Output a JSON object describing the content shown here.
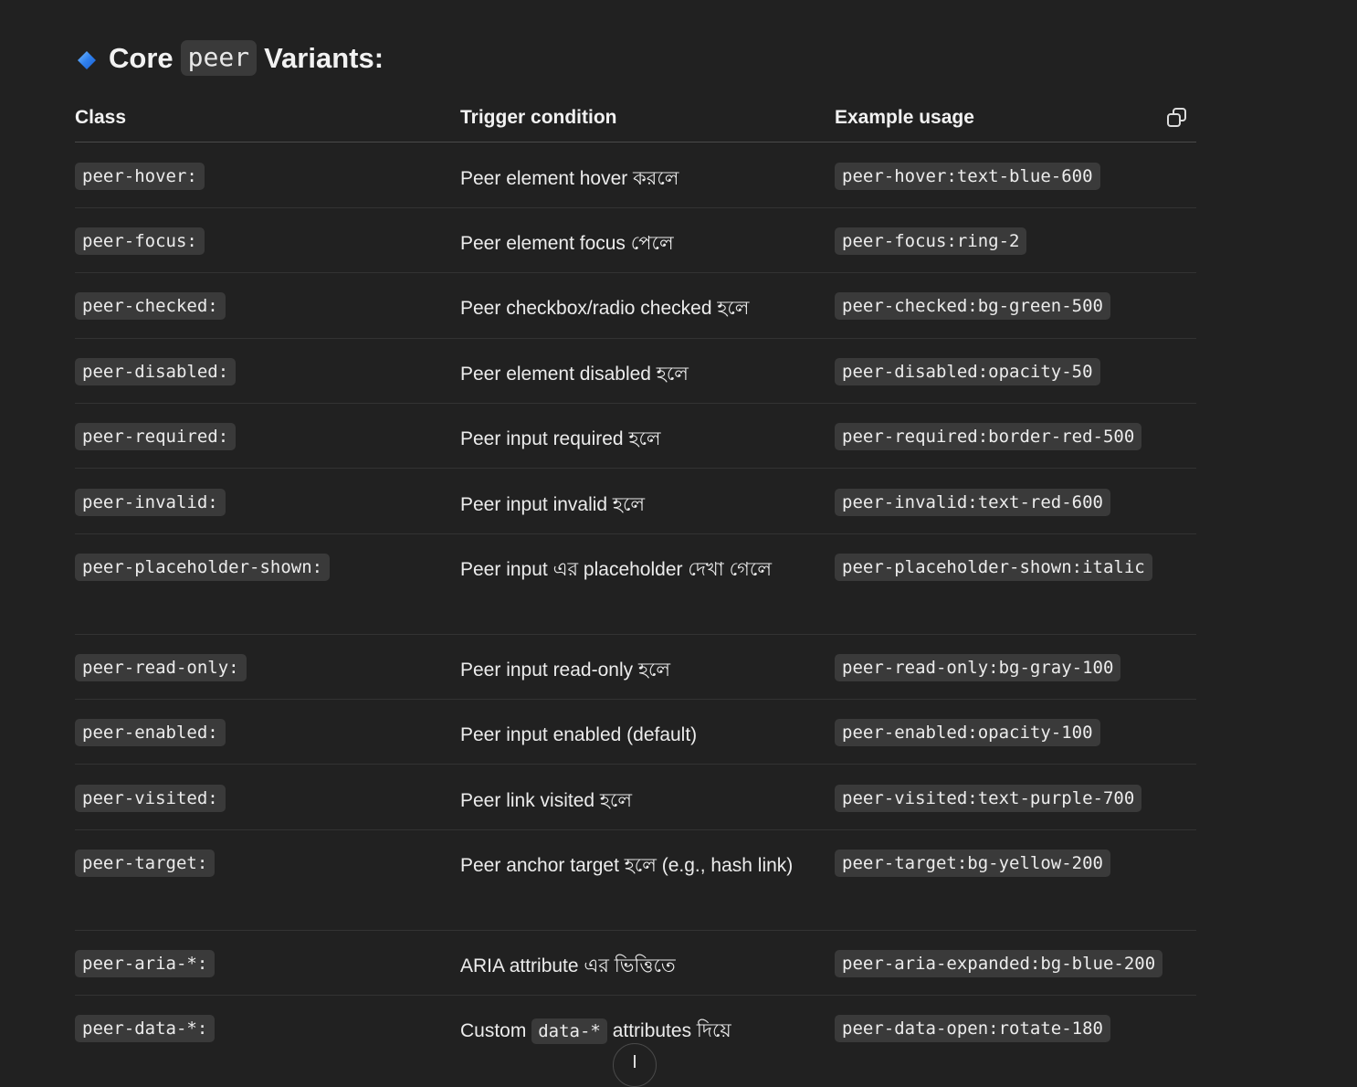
{
  "heading": {
    "prefix": "Core",
    "code": "peer",
    "suffix": "Variants:",
    "icon": "blue-diamond-icon",
    "icon_color": "#3b82f6"
  },
  "table": {
    "headers": {
      "class": "Class",
      "trigger": "Trigger condition",
      "example": "Example usage"
    },
    "rows": [
      {
        "class": "peer-hover:",
        "trigger": "Peer element hover করলে",
        "example": "peer-hover:text-blue-600"
      },
      {
        "class": "peer-focus:",
        "trigger": "Peer element focus পেলে",
        "example": "peer-focus:ring-2"
      },
      {
        "class": "peer-checked:",
        "trigger": "Peer checkbox/radio checked হলে",
        "example": "peer-checked:bg-green-500"
      },
      {
        "class": "peer-disabled:",
        "trigger": "Peer element disabled হলে",
        "example": "peer-disabled:opacity-50"
      },
      {
        "class": "peer-required:",
        "trigger": "Peer input required হলে",
        "example": "peer-required:border-red-500"
      },
      {
        "class": "peer-invalid:",
        "trigger": "Peer input invalid হলে",
        "example": "peer-invalid:text-red-600"
      },
      {
        "class": "peer-placeholder-shown:",
        "trigger": "Peer input এর placeholder দেখা গেলে",
        "example": "peer-placeholder-shown:italic"
      },
      {
        "class": "peer-read-only:",
        "trigger": "Peer input read-only হলে",
        "example": "peer-read-only:bg-gray-100"
      },
      {
        "class": "peer-enabled:",
        "trigger": "Peer input enabled (default)",
        "example": "peer-enabled:opacity-100"
      },
      {
        "class": "peer-visited:",
        "trigger": "Peer link visited হলে",
        "example": "peer-visited:text-purple-700"
      },
      {
        "class": "peer-target:",
        "trigger": "Peer anchor target হলে (e.g., hash link)",
        "example": "peer-target:bg-yellow-200"
      },
      {
        "class": "peer-aria-*:",
        "trigger": "ARIA attribute এর ভিত্তিতে",
        "example": "peer-aria-expanded:bg-blue-200"
      },
      {
        "class": "peer-data-*:",
        "trigger_before": "Custom",
        "trigger_code": "data-*",
        "trigger_after": "attributes দিয়ে",
        "example": "peer-data-open:rotate-180"
      }
    ]
  },
  "controls": {
    "copy_icon": "copy-icon",
    "scroll_icon": "arrow-down-icon"
  }
}
